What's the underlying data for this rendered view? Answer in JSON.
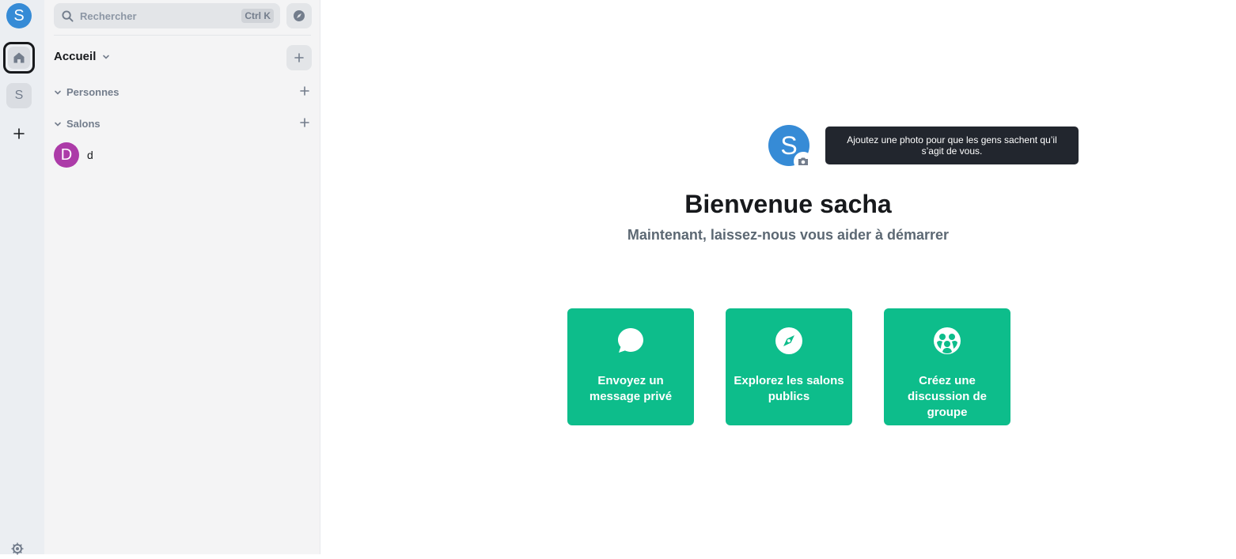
{
  "spaces": {
    "user_avatar_letter": "S",
    "space_s_letter": "S",
    "add_space_label": "+"
  },
  "room_list": {
    "search": {
      "label": "Rechercher",
      "shortcut": "Ctrl K"
    },
    "home_title": "Accueil",
    "sections": [
      {
        "label": "Personnes"
      },
      {
        "label": "Salons"
      }
    ],
    "rooms": [
      {
        "avatar_letter": "D",
        "name": "d"
      }
    ]
  },
  "main": {
    "profile_avatar_letter": "S",
    "tooltip": "Ajoutez une photo pour que les gens sachent qu’il s’agit de vous.",
    "welcome_title": "Bienvenue sacha",
    "welcome_subtitle": "Maintenant, laissez-nous vous aider à démarrer",
    "actions": [
      {
        "label": "Envoyez un message privé",
        "icon": "chat-bubble-icon"
      },
      {
        "label": "Explorez les salons publics",
        "icon": "compass-icon"
      },
      {
        "label": "Créez une discussion de groupe",
        "icon": "group-icon"
      }
    ]
  },
  "colors": {
    "accent": "#0dbd8b",
    "user_avatar": "#368bd6",
    "room_avatar": "#ac3ba8",
    "tooltip_bg": "#22262e"
  }
}
